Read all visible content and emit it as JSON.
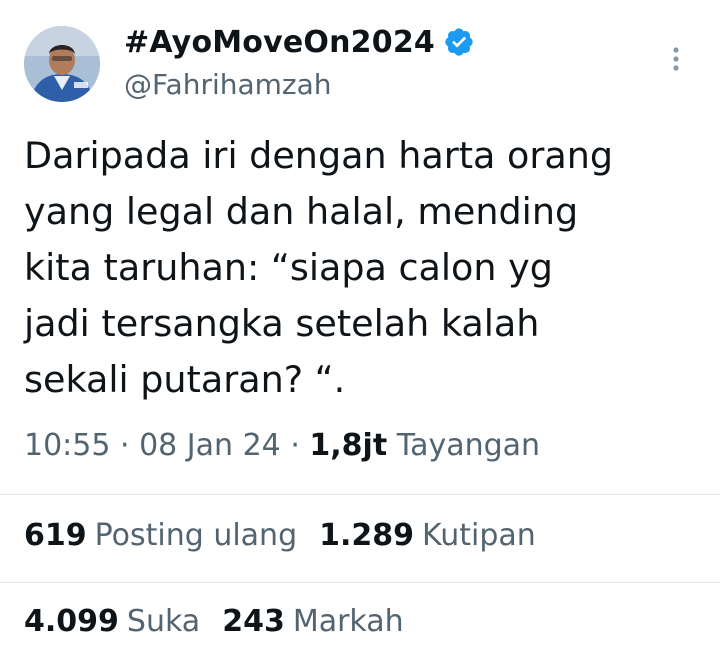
{
  "author": {
    "display_name": "#AyoMoveOn2024",
    "handle": "@Fahrihamzah",
    "verified": true,
    "avatar_icon": "profile-photo"
  },
  "tweet": {
    "lines": [
      "Daripada iri dengan harta orang",
      "yang legal dan halal, mending",
      "kita taruhan: “siapa calon yg",
      "jadi tersangka setelah kalah",
      "sekali putaran? “."
    ]
  },
  "meta": {
    "time": "10:55",
    "date": "08 Jan 24",
    "separator": "·",
    "views_count": "1,8jt",
    "views_label": "Tayangan"
  },
  "stats": {
    "reposts": {
      "count": "619",
      "label": "Posting ulang"
    },
    "quotes": {
      "count": "1.289",
      "label": "Kutipan"
    },
    "likes": {
      "count": "4.099",
      "label": "Suka"
    },
    "bookmarks": {
      "count": "243",
      "label": "Markah"
    }
  },
  "colors": {
    "text_primary": "#0f1419",
    "text_secondary": "#536471",
    "verified_blue": "#1d9bf0",
    "divider": "#e1e6ea"
  }
}
